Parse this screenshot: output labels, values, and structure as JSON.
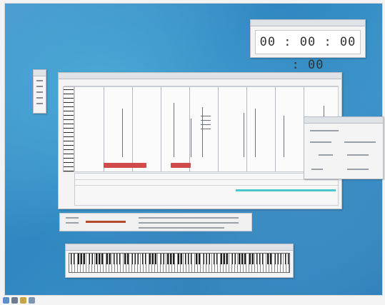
{
  "timer": {
    "display": "00 : 00 : 00 : 00"
  },
  "icons": [
    "palette-icon",
    "piano-keyboard-icon",
    "folder-icon",
    "speaker-icon"
  ],
  "colors": {
    "desktop": "#3a8fc7",
    "accent_red": "#d24b4b",
    "accent_cyan": "#48c8c8"
  }
}
